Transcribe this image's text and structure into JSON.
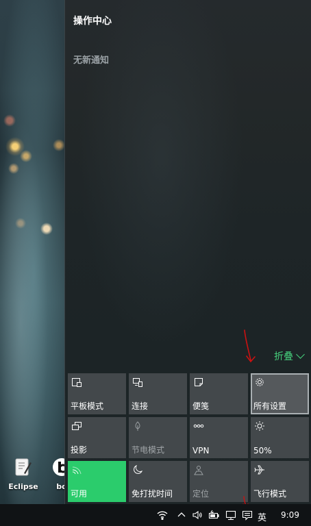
{
  "desktop": {
    "icons": [
      {
        "label": "Eclipse"
      },
      {
        "label": "bo"
      }
    ]
  },
  "action_center": {
    "title": "操作中心",
    "no_notifications": "无新通知",
    "collapse_label": "折叠",
    "tiles": [
      {
        "label": "平板模式",
        "icon": "tablet-mode-icon",
        "state": "off"
      },
      {
        "label": "连接",
        "icon": "connect-icon",
        "state": "off"
      },
      {
        "label": "便笺",
        "icon": "note-icon",
        "state": "off"
      },
      {
        "label": "所有设置",
        "icon": "gear-icon",
        "state": "focused"
      },
      {
        "label": "投影",
        "icon": "project-icon",
        "state": "off"
      },
      {
        "label": "节电模式",
        "icon": "battery-saver-icon",
        "state": "disabled"
      },
      {
        "label": "VPN",
        "icon": "vpn-icon",
        "state": "off"
      },
      {
        "label": "50%",
        "icon": "brightness-icon",
        "state": "off"
      },
      {
        "label": "可用",
        "icon": "wifi-icon",
        "state": "on"
      },
      {
        "label": "免打扰时间",
        "icon": "moon-icon",
        "state": "off"
      },
      {
        "label": "定位",
        "icon": "location-icon",
        "state": "disabled"
      },
      {
        "label": "飞行模式",
        "icon": "airplane-icon",
        "state": "off"
      }
    ],
    "colors": {
      "accent": "#2bcc6c",
      "collapse": "#46d07c",
      "tile": "#43484b"
    }
  },
  "taskbar": {
    "tray_icons": [
      "wifi-icon",
      "chevron-up-icon",
      "speaker-icon",
      "battery-icon",
      "network-icon",
      "action-center-icon"
    ],
    "language": "英",
    "time": "9:09"
  }
}
